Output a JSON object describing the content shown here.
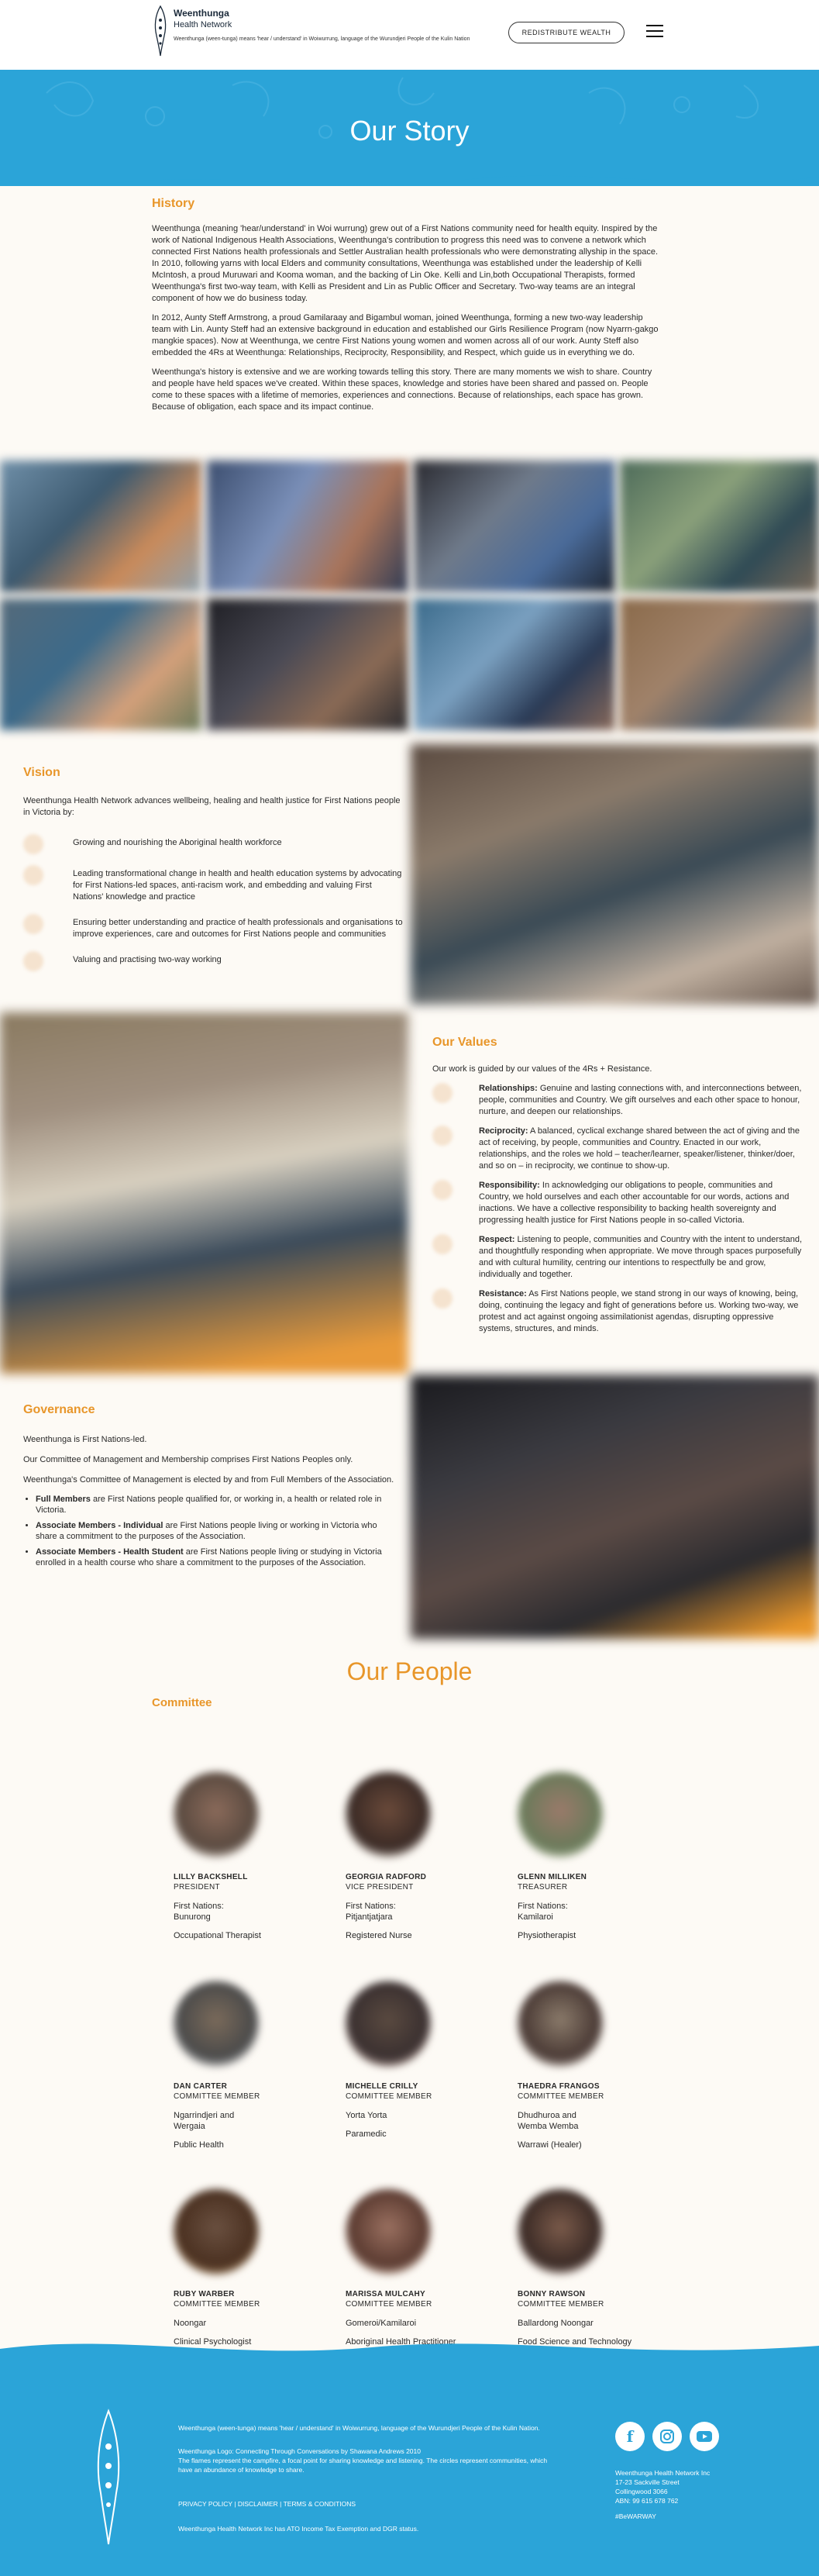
{
  "header": {
    "logo_name": "Weenthunga",
    "logo_sub": "Health Network",
    "logo_tagline": "Weenthunga (ween-tunga) means 'hear / understand' in Woiwurrung, language of the Wurundjeri People of the Kulin Nation",
    "redistribute_label": "REDISTRIBUTE WEALTH"
  },
  "hero": {
    "title": "Our Story"
  },
  "history": {
    "heading": "History",
    "p1": "Weenthunga (meaning 'hear/understand' in Woi wurrung) grew out of a First Nations community need for health equity. Inspired by the work of National Indigenous Health Associations, Weenthunga's contribution to progress this need was to convene a network which connected First Nations health professionals and Settler Australian health professionals who were demonstrating allyship in the space. In 2010, following yarns with local Elders and community consultations, Weenthunga was established under the leadership of Kelli McIntosh, a proud Muruwari and Kooma woman, and the backing of Lin Oke. Kelli and Lin,both Occupational Therapists, formed Weenthunga's first two-way team, with Kelli as President and Lin as Public Officer and Secretary. Two-way teams are an integral component of how we do business today.",
    "p2": "In 2012, Aunty Steff Armstrong, a proud Gamilaraay and Bigambul woman, joined Weenthunga, forming a new two-way leadership team with Lin. Aunty Steff had an extensive background in education and established our Girls Resilience Program (now Nyarrn-gakgo mangkie spaces). Now at Weenthunga, we centre First Nations young women and women across all of our work. Aunty Steff also embedded the 4Rs at Weenthunga: Relationships, Reciprocity, Responsibility, and Respect, which guide us in everything we do.",
    "p3": "Weenthunga's history is extensive and we are working towards telling this story. There are many moments we wish to share. Country and people have held spaces we've created. Within these spaces, knowledge and stories have been shared and passed on. People come to these spaces with a lifetime of memories, experiences and connections. Because of relationships, each space has grown. Because of obligation, each space and its impact continue."
  },
  "vision": {
    "heading": "Vision",
    "intro": "Weenthunga Health Network advances wellbeing, healing and health justice for First Nations people in Victoria by:",
    "items": [
      "Growing and nourishing the Aboriginal health workforce",
      "Leading transformational change in health and health education systems by advocating for First Nations-led spaces, anti-racism work, and embedding and valuing First Nations' knowledge and practice",
      "Ensuring better understanding and practice of health professionals and organisations to improve experiences, care and outcomes for First Nations people and communities",
      "Valuing and practising two-way working"
    ]
  },
  "values": {
    "heading": "Our Values",
    "intro": "Our work is guided by our values of the 4Rs + Resistance.",
    "items": [
      {
        "term": "Relationships:",
        "text": " Genuine and lasting connections with, and interconnections between, people, communities and Country. We gift ourselves and each other space to honour, nurture, and deepen our relationships."
      },
      {
        "term": "Reciprocity:",
        "text": " A balanced, cyclical exchange shared between the act of giving and the act of receiving, by people, communities and Country. Enacted in our work, relationships, and the roles we hold – teacher/learner, speaker/listener, thinker/doer, and so on – in reciprocity, we continue to show-up."
      },
      {
        "term": "Responsibility:",
        "text": " In acknowledging our obligations to people, communities and Country, we hold ourselves and each other accountable for our words, actions and inactions. We have a collective responsibility to backing health sovereignty and progressing health justice for First Nations people in so-called Victoria."
      },
      {
        "term": "Respect:",
        "text": " Listening to people, communities and Country with the intent to understand, and thoughtfully responding when appropriate. We move through spaces purposefully and with cultural humility, centring our intentions to respectfully be and grow, individually and together."
      },
      {
        "term": "Resistance:",
        "text": " As First Nations people, we stand strong in our ways of knowing, being, doing, continuing the legacy and fight of generations before us. Working two-way, we protest and act against ongoing assimilationist agendas, disrupting oppressive systems, structures, and minds."
      }
    ]
  },
  "governance": {
    "heading": "Governance",
    "p1": "Weenthunga is First Nations-led.",
    "p2": "Our Committee of Management and Membership comprises First Nations Peoples only.",
    "p3": "Weenthunga's Committee of Management is elected by and from Full Members of the Association.",
    "items": [
      {
        "term": "Full Members",
        "text": " are First Nations people qualified for, or working in, a health or related role in Victoria."
      },
      {
        "term": "Associate Members - Individual",
        "text": " are First Nations people living or working in Victoria who share a commitment to the purposes of the Association."
      },
      {
        "term": "Associate Members - Health Student",
        "text": " are First Nations people living or studying in Victoria enrolled in a health course who share a commitment to the purposes of the Association."
      }
    ]
  },
  "people": {
    "title": "Our People",
    "committee_heading": "Committee",
    "members": [
      {
        "name": "LILLY BACKSHELL",
        "role": "PRESIDENT",
        "nation": "First Nations: Bunurong",
        "profession": "Occupational Therapist"
      },
      {
        "name": "GEORGIA RADFORD",
        "role": "VICE PRESIDENT",
        "nation": "First Nations: Pitjantjatjara",
        "profession": "Registered Nurse"
      },
      {
        "name": "GLENN MILLIKEN",
        "role": "TREASURER",
        "nation": "First Nations: Kamilaroi",
        "profession": "Physiotherapist"
      },
      {
        "name": "DAN CARTER",
        "role": "COMMITTEE MEMBER",
        "nation": "Ngarrindjeri and Wergaia",
        "profession": "Public Health"
      },
      {
        "name": "MICHELLE CRILLY",
        "role": "COMMITTEE MEMBER",
        "nation": "Yorta Yorta",
        "profession": "Paramedic"
      },
      {
        "name": "THAEDRA FRANGOS",
        "role": "COMMITTEE MEMBER",
        "nation": "Dhudhuroa and Wemba Wemba",
        "profession": "Warrawi (Healer)"
      },
      {
        "name": "RUBY WARBER",
        "role": "COMMITTEE MEMBER",
        "nation": "Noongar",
        "profession": "Clinical Psychologist"
      },
      {
        "name": "MARISSA MULCAHY",
        "role": "COMMITTEE MEMBER",
        "nation": "Gomeroi/Kamilaroi",
        "profession": "Aboriginal Health Practitioner"
      },
      {
        "name": "BONNY RAWSON",
        "role": "COMMITTEE MEMBER",
        "nation": "Ballardong Noongar",
        "profession": "Food Science and Technology"
      }
    ]
  },
  "footer": {
    "meaning": "Weenthunga (ween-tunga) means 'hear / understand' in Woiwurrung, language of the Wurundjeri People of the Kulin Nation.",
    "logo_credit": "Weenthunga Logo: Connecting Through Conversations by Shawana Andrews 2010",
    "logo_desc": "The flames represent the campfire, a focal point for sharing knowledge and listening. The circles represent communities, which have an abundance of knowledge to share.",
    "links": "PRIVACY POLICY | DISCLAIMER | TERMS & CONDITIONS",
    "tax": "Weenthunga Health Network Inc has ATO Income Tax Exemption and DGR status.",
    "address_name": "Weenthunga Health Network Inc",
    "address_line1": "17-23 Sackville Street",
    "address_line2": "Collingwood 3066",
    "abn": "ABN: 99 615 678 762",
    "hashtag": "#BeWARWAY"
  },
  "colors": {
    "accent": "#e8962a",
    "brand_blue": "#2ba4d8",
    "background": "#fdfaf5"
  }
}
